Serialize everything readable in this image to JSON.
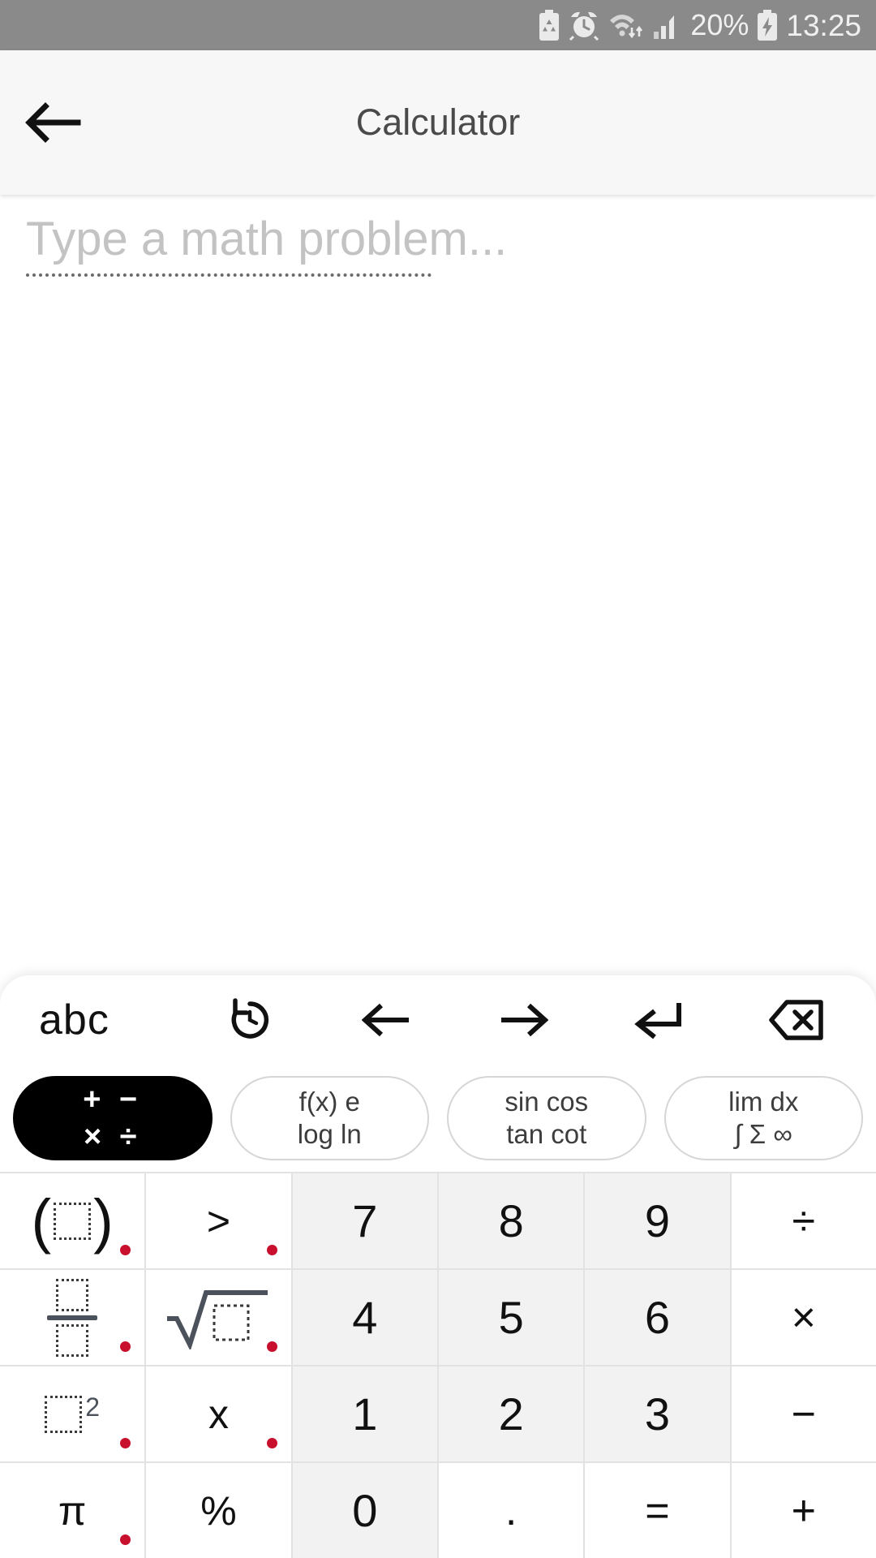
{
  "statusbar": {
    "icons": [
      "power-saving-battery-icon",
      "alarm-clock-icon",
      "wifi-icon",
      "signal-bars-icon",
      "charging-battery-icon"
    ],
    "battery_percent": "20%",
    "time": "13:25"
  },
  "appbar": {
    "back_icon": "back-arrow-icon",
    "title": "Calculator"
  },
  "input": {
    "placeholder": "Type a math problem...",
    "value": ""
  },
  "keyboard": {
    "toolbar": [
      {
        "name": "abc-toggle",
        "label": "abc",
        "type": "text"
      },
      {
        "name": "history-button",
        "label": "",
        "type": "icon",
        "icon": "history-icon"
      },
      {
        "name": "cursor-left-button",
        "label": "",
        "type": "icon",
        "icon": "arrow-left-icon"
      },
      {
        "name": "cursor-right-button",
        "label": "",
        "type": "icon",
        "icon": "arrow-right-icon"
      },
      {
        "name": "enter-button",
        "label": "",
        "type": "icon",
        "icon": "enter-return-icon"
      },
      {
        "name": "backspace-button",
        "label": "",
        "type": "icon",
        "icon": "backspace-icon"
      }
    ],
    "pills": [
      {
        "name": "pill-basic-operators",
        "line1": "+ −",
        "line2": "× ÷",
        "active": true
      },
      {
        "name": "pill-functions",
        "line1": "f(x)  e",
        "line2": "log  ln",
        "active": false
      },
      {
        "name": "pill-trigonometry",
        "line1": "sin cos",
        "line2": "tan cot",
        "active": false
      },
      {
        "name": "pill-calculus",
        "line1": "lim  dx",
        "line2": "∫ Σ ∞",
        "active": false
      }
    ],
    "rows": [
      [
        {
          "name": "key-parentheses",
          "glyph": "parentheses",
          "kind": "sym",
          "dot": true
        },
        {
          "name": "key-greater-than",
          "label": ">",
          "kind": "sym",
          "dot": true
        },
        {
          "name": "key-7",
          "label": "7",
          "kind": "num",
          "dot": false
        },
        {
          "name": "key-8",
          "label": "8",
          "kind": "num",
          "dot": false
        },
        {
          "name": "key-9",
          "label": "9",
          "kind": "num",
          "dot": false
        },
        {
          "name": "key-divide",
          "label": "÷",
          "kind": "op",
          "dot": false
        }
      ],
      [
        {
          "name": "key-fraction",
          "glyph": "fraction",
          "kind": "sym",
          "dot": true
        },
        {
          "name": "key-square-root",
          "glyph": "sqrt",
          "kind": "sym",
          "dot": true
        },
        {
          "name": "key-4",
          "label": "4",
          "kind": "num",
          "dot": false
        },
        {
          "name": "key-5",
          "label": "5",
          "kind": "num",
          "dot": false
        },
        {
          "name": "key-6",
          "label": "6",
          "kind": "num",
          "dot": false
        },
        {
          "name": "key-multiply",
          "label": "×",
          "kind": "op",
          "dot": false
        }
      ],
      [
        {
          "name": "key-power-squared",
          "glyph": "square",
          "kind": "sym",
          "dot": true
        },
        {
          "name": "key-variable-x",
          "label": "x",
          "kind": "sym",
          "dot": true
        },
        {
          "name": "key-1",
          "label": "1",
          "kind": "num",
          "dot": false
        },
        {
          "name": "key-2",
          "label": "2",
          "kind": "num",
          "dot": false
        },
        {
          "name": "key-3",
          "label": "3",
          "kind": "num",
          "dot": false
        },
        {
          "name": "key-minus",
          "label": "−",
          "kind": "op",
          "dot": false
        }
      ],
      [
        {
          "name": "key-pi",
          "label": "π",
          "kind": "sym",
          "dot": true
        },
        {
          "name": "key-percent",
          "label": "%",
          "kind": "sym",
          "dot": false
        },
        {
          "name": "key-0",
          "label": "0",
          "kind": "num",
          "dot": false
        },
        {
          "name": "key-decimal-point",
          "label": ".",
          "kind": "op",
          "dot": false
        },
        {
          "name": "key-equals",
          "label": "=",
          "kind": "op",
          "dot": false
        },
        {
          "name": "key-plus",
          "label": "+",
          "kind": "op",
          "dot": false
        }
      ]
    ]
  },
  "colors": {
    "statusbar_bg": "#8a8a8a",
    "appbar_bg": "#f7f7f7",
    "number_key_bg": "#f2f2f2",
    "function_key_bg": "#ffffff",
    "longpress_dot": "#c8102e",
    "active_pill_bg": "#000000",
    "placeholder_text": "#c3c3c3"
  }
}
